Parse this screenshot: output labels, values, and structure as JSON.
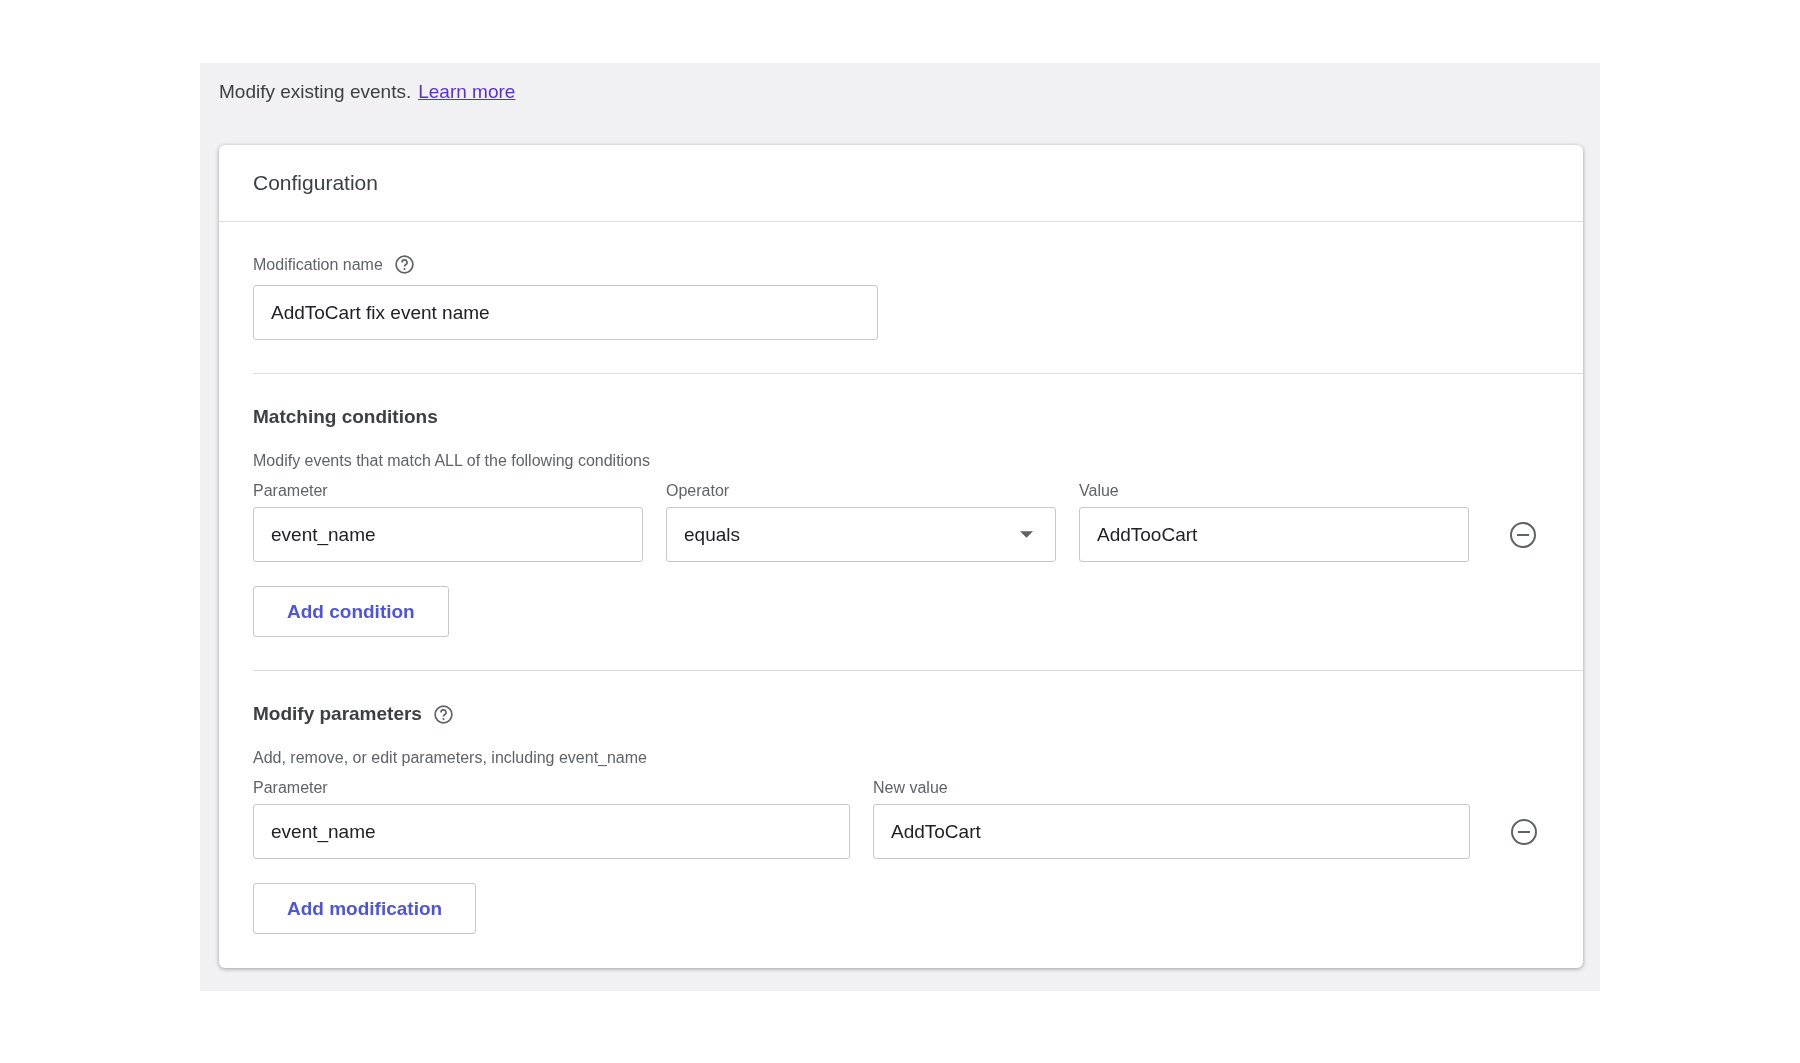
{
  "intro": {
    "text": "Modify existing events.",
    "link": "Learn more"
  },
  "card": {
    "title": "Configuration"
  },
  "modification_name": {
    "label": "Modification name",
    "value": "AddToCart fix event name"
  },
  "matching": {
    "title": "Matching conditions",
    "description": "Modify events that match ALL of the following conditions",
    "columns": [
      "Parameter",
      "Operator",
      "Value"
    ],
    "rows": [
      {
        "parameter": "event_name",
        "operator": "equals",
        "value": "AddTooCart"
      }
    ],
    "add_button": "Add condition"
  },
  "modify": {
    "title": "Modify parameters",
    "description": "Add, remove, or edit parameters, including event_name",
    "columns": [
      "Parameter",
      "New value"
    ],
    "rows": [
      {
        "parameter": "event_name",
        "new_value": "AddToCart"
      }
    ],
    "add_button": "Add modification"
  }
}
